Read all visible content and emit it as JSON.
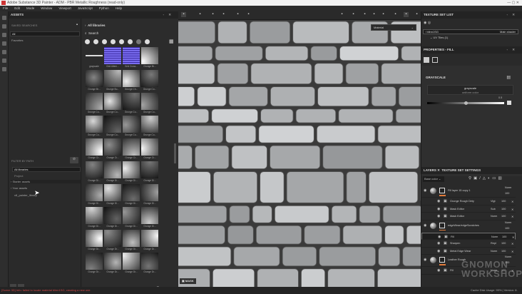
{
  "window": {
    "title": "Adobe Substance 3D Painter - ADM - PBR Metallic Roughness (read-only)",
    "controls": "—  ▢  ✕"
  },
  "menu": [
    "File",
    "Edit",
    "Mode",
    "Window",
    "Viewport",
    "JavaScript",
    "Python",
    "Help"
  ],
  "assets": {
    "title": "ASSETS",
    "saved_searches": "SAVED SEARCHES",
    "search_items": [
      "All",
      "Favorites"
    ],
    "filter_by_path": "FILTER BY PATH",
    "paths": [
      "All libraries",
      "Project",
      "Starter assets",
      "Your assets",
      "v8_painter_library"
    ],
    "breadcrumb": "All libraries",
    "search_placeholder": "Search",
    "thumbs": [
      "grayscale",
      "Grid Altern...",
      "Grid Cross...",
      "Grunge Br...",
      "Grunge Br...",
      "Grunge Bu...",
      "Grunge Ch...",
      "Grunge Co...",
      "Grunge Co...",
      "Grunge Co...",
      "Grunge Co...",
      "Grunge Co...",
      "Grunge Co...",
      "Grunge Co...",
      "Grunge Co...",
      "Grunge Co...",
      "Grunge Cr...",
      "Grunge Cr...",
      "Grunge Cr...",
      "Grunge Cr...",
      "Grunge Di...",
      "Grunge Di...",
      "Grunge Di...",
      "Grunge Di...",
      "Grunge Di...",
      "Grunge Di...",
      "Grunge Di...",
      "Grunge Di...",
      "Grunge Di...",
      "Grunge Di...",
      "Grunge Di...",
      "Grunge Di...",
      "Grunge Dr...",
      "Grunge Dr...",
      "Grunge Dr...",
      "Grunge Dr...",
      "Grunge Dr...",
      "Grunge Dr...",
      "Grunge Dr...",
      "Grunge Dr..."
    ]
  },
  "viewport": {
    "mode_select": "Material",
    "mask_label": "MASK"
  },
  "texture_set_list": {
    "title": "TEXTURE SET LIST",
    "set_name": "blinn1SG",
    "shader": "Main shader",
    "uv_tiles": "UV Tiles (1)"
  },
  "properties": {
    "title": "PROPERTIES - FILL",
    "section": "GRAYSCALE",
    "source_name": "grayscale",
    "source_type": "uniform color",
    "value": "0.5",
    "value_fraction": 0.5
  },
  "layers": {
    "tab_layers": "LAYERS",
    "tab_tss": "TEXTURE SET SETTINGS",
    "channel": "Base color",
    "items": [
      {
        "name": "Fill layer 15 copy 1",
        "blend": "Norm",
        "opacity": "100",
        "group": true
      },
      {
        "name": "Grunge Rough Dirty",
        "blend": "Vlgt",
        "opacity": "100"
      },
      {
        "name": "Mask Editor",
        "blend": "Sub",
        "opacity": "100"
      },
      {
        "name": "Mask Editor",
        "blend": "Norm",
        "opacity": "100"
      },
      {
        "name": "edgeWear/edgeScratches",
        "blend": "Norm",
        "opacity": "100",
        "group": true
      },
      {
        "name": "Fill",
        "blend": "Norm",
        "opacity": "100",
        "selected": true
      },
      {
        "name": "Sharpen",
        "blend": "Repl",
        "opacity": "100"
      },
      {
        "name": "Metal Edge Wear",
        "blend": "Norm",
        "opacity": "100"
      },
      {
        "name": "Leather Rough",
        "blend": "Norm",
        "opacity": "100",
        "group": true
      },
      {
        "name": "Fill",
        "blend": "Norm",
        "opacity": "100"
      }
    ]
  },
  "status": {
    "error": "[Scene 3D] Info: failed to locate material blinn1SG, creating a new one.",
    "cache": "Cache Disk Usage:",
    "cache_value": "99%",
    "version": "Version: 8."
  },
  "watermark": "THE GNOMON WORKSHOP"
}
